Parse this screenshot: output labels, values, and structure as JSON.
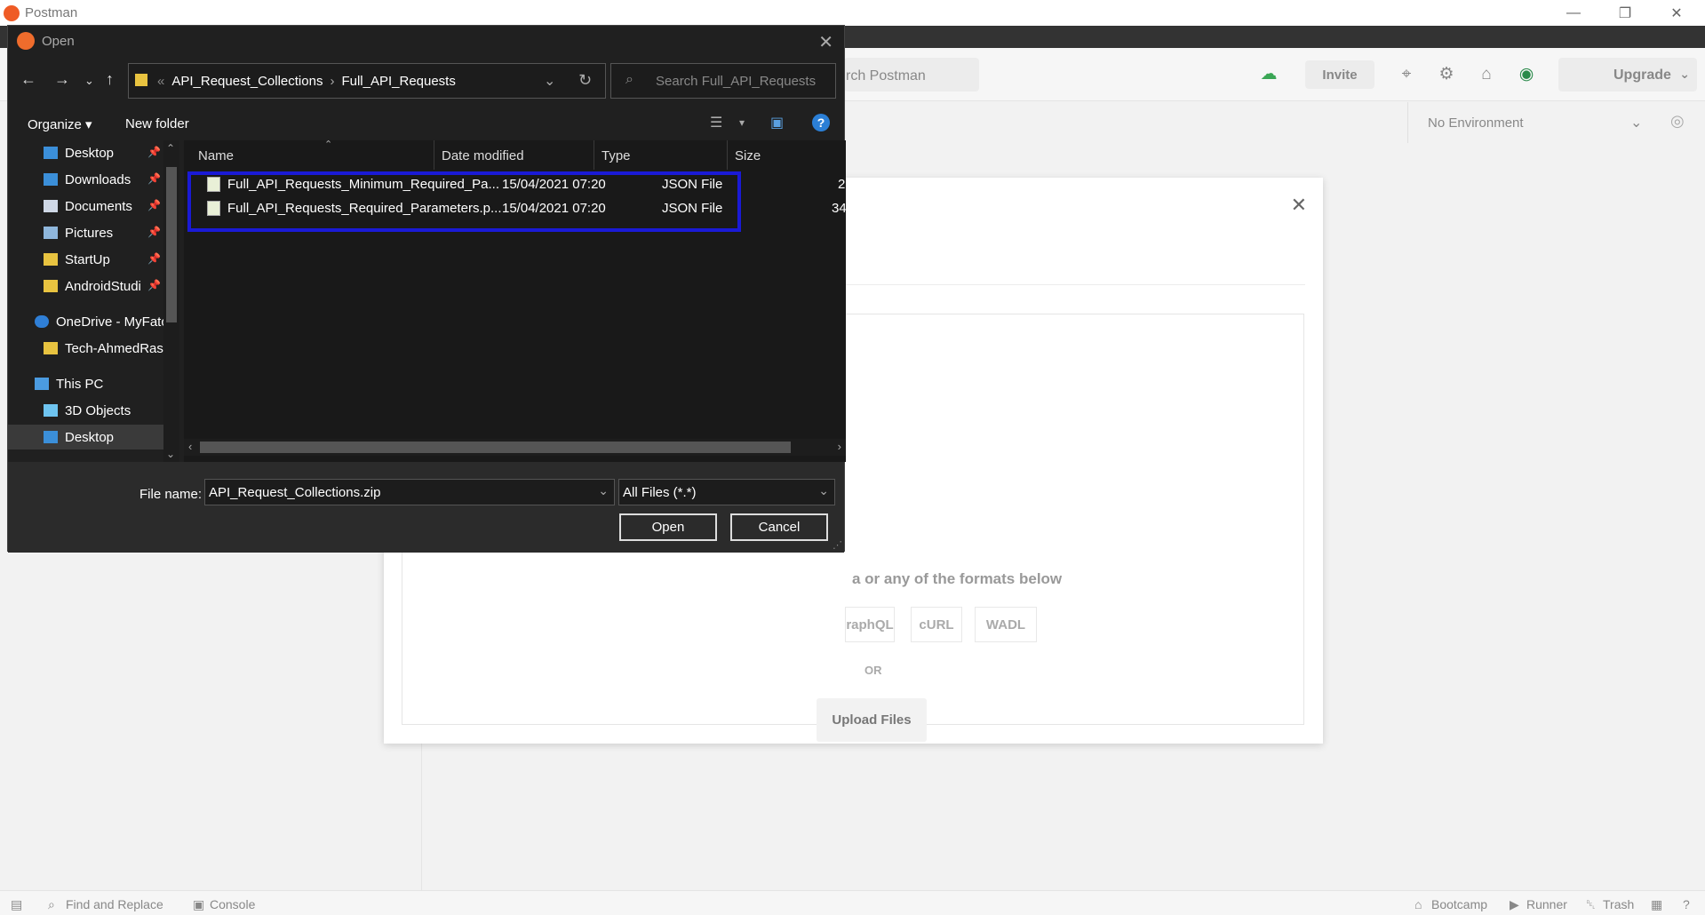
{
  "app": {
    "title": "Postman",
    "search_placeholder": "rch Postman",
    "invite_label": "Invite",
    "upgrade_label": "Upgrade",
    "environment": "No Environment",
    "statusbar": {
      "find_replace": "Find and Replace",
      "console": "Console",
      "bootcamp": "Bootcamp",
      "runner": "Runner",
      "trash": "Trash"
    }
  },
  "import_modal": {
    "dropzone_text": "a or any of the formats below",
    "formats": [
      "raphQL",
      "cURL",
      "WADL"
    ],
    "or_label": "OR",
    "upload_label": "Upload Files"
  },
  "dialog": {
    "title": "Open",
    "path": [
      "API_Request_Collections",
      "Full_API_Requests"
    ],
    "search_placeholder": "Search Full_API_Requests",
    "organize_label": "Organize",
    "new_folder_label": "New folder",
    "nav_items": [
      {
        "label": "Desktop",
        "pinned": true
      },
      {
        "label": "Downloads",
        "pinned": true
      },
      {
        "label": "Documents",
        "pinned": true
      },
      {
        "label": "Pictures",
        "pinned": true
      },
      {
        "label": "StartUp",
        "pinned": true
      },
      {
        "label": "AndroidStudi",
        "pinned": true
      },
      {
        "label": "OneDrive - MyFatc",
        "pinned": false
      },
      {
        "label": "Tech-AhmedRasl",
        "pinned": false
      },
      {
        "label": "This PC",
        "pinned": false
      },
      {
        "label": "3D Objects",
        "pinned": false
      },
      {
        "label": "Desktop",
        "pinned": false
      }
    ],
    "columns": [
      "Name",
      "Date modified",
      "Type",
      "Size"
    ],
    "files": [
      {
        "name": "Full_API_Requests_Minimum_Required_Pa...",
        "date": "15/04/2021 07:20",
        "type": "JSON File",
        "size": "2"
      },
      {
        "name": "Full_API_Requests_Required_Parameters.p...",
        "date": "15/04/2021 07:20",
        "type": "JSON File",
        "size": "34"
      }
    ],
    "file_name_label": "File name:",
    "file_name_value": "API_Request_Collections.zip",
    "filter_value": "All Files (*.*)",
    "open_label": "Open",
    "cancel_label": "Cancel"
  },
  "colors": {
    "postman_orange": "#ef5b25",
    "dialog_bg": "#202020",
    "highlight_border": "#1a1ad6",
    "help_blue": "#2b7fd6"
  }
}
